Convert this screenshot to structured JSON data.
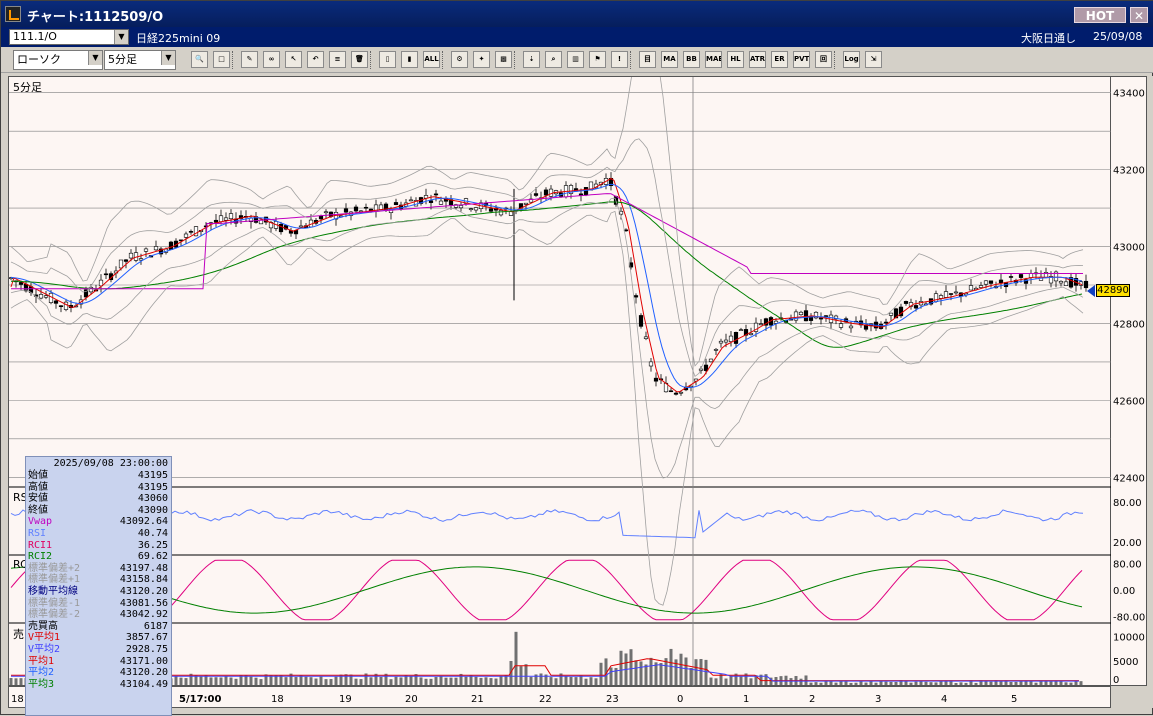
{
  "window": {
    "title": "チャート:1112509/O",
    "hot_label": "HOT",
    "close_label": "✕"
  },
  "infobar": {
    "symbol": "111.1/O",
    "instrument": "日経225mini 09",
    "market": "大阪日通し",
    "date": "25/09/08"
  },
  "toolbar": {
    "chart_style": "ローソク",
    "interval": "5分足",
    "buttons": [
      {
        "name": "zoom",
        "label": "🔍"
      },
      {
        "name": "window",
        "label": "□"
      },
      {
        "name": "draw-line",
        "label": "✎"
      },
      {
        "name": "link",
        "label": "∞"
      },
      {
        "name": "cursor",
        "label": "↖"
      },
      {
        "name": "undo",
        "label": "↶"
      },
      {
        "name": "notes",
        "label": "≡"
      },
      {
        "name": "trash",
        "label": "🗑"
      },
      {
        "name": "candle",
        "label": "▯"
      },
      {
        "name": "bars",
        "label": "▮"
      },
      {
        "name": "all",
        "label": "ALL"
      },
      {
        "name": "settings",
        "label": "⚙"
      },
      {
        "name": "wrench",
        "label": "✦"
      },
      {
        "name": "color",
        "label": "▩"
      },
      {
        "name": "import",
        "label": "⇣"
      },
      {
        "name": "search",
        "label": "⌕"
      },
      {
        "name": "volume",
        "label": "▥"
      },
      {
        "name": "flag",
        "label": "⚑"
      },
      {
        "name": "blank",
        "label": "!"
      },
      {
        "name": "ichimoku",
        "label": "目"
      },
      {
        "name": "ma",
        "label": "MA"
      },
      {
        "name": "bb",
        "label": "BB"
      },
      {
        "name": "mae",
        "label": "MAE"
      },
      {
        "name": "hl",
        "label": "HL"
      },
      {
        "name": "atr",
        "label": "ATR"
      },
      {
        "name": "env",
        "label": "ER"
      },
      {
        "name": "pvt",
        "label": "PVT"
      },
      {
        "name": "box",
        "label": "回"
      },
      {
        "name": "log",
        "label": "Log"
      },
      {
        "name": "export",
        "label": "⇲"
      }
    ]
  },
  "chart": {
    "panel_label": "5分足",
    "rsi_label": "RS",
    "rci_label": "RC",
    "vol_label": "売",
    "current_price": "42890",
    "price_ticks": [
      "43400",
      "43200",
      "43000",
      "42800",
      "42600",
      "42400"
    ],
    "rsi_ticks": [
      "80.00",
      "20.00"
    ],
    "rci_ticks": [
      "80.00",
      "0.00",
      "-80.00"
    ],
    "vol_ticks": [
      "10000",
      "5000",
      "0"
    ],
    "x_labels": [
      "18",
      "5/17:00",
      "18",
      "19",
      "20",
      "21",
      "22",
      "23",
      "0",
      "1",
      "2",
      "3",
      "4",
      "5"
    ]
  },
  "chart_data": {
    "type": "candlestick",
    "ylim": [
      42380,
      43420
    ],
    "current": 42890,
    "series_names": [],
    "indicators": {
      "rsi_range": [
        0,
        100
      ],
      "rci_range": [
        -100,
        100
      ],
      "vol_range": [
        0,
        12000
      ]
    }
  },
  "info": {
    "datetime": "2025/09/08 23:00:00",
    "rows": [
      {
        "label": "始値",
        "value": "43195",
        "color": "#000"
      },
      {
        "label": "高値",
        "value": "43195",
        "color": "#000"
      },
      {
        "label": "安値",
        "value": "43060",
        "color": "#000"
      },
      {
        "label": "終値",
        "value": "43090",
        "color": "#000"
      },
      {
        "label": "Vwap",
        "value": "43092.64",
        "color": "#c000c0"
      },
      {
        "label": "RSI",
        "value": "40.74",
        "color": "#6080ff"
      },
      {
        "label": "RCI1",
        "value": "36.25",
        "color": "#e00060"
      },
      {
        "label": "RCI2",
        "value": "69.62",
        "color": "#008000"
      },
      {
        "label": "標準偏差+2",
        "value": "43197.48",
        "color": "#999"
      },
      {
        "label": "標準偏差+1",
        "value": "43158.84",
        "color": "#999"
      },
      {
        "label": "移動平均線",
        "value": "43120.20",
        "color": "#000080"
      },
      {
        "label": "標準偏差-1",
        "value": "43081.56",
        "color": "#999"
      },
      {
        "label": "標準偏差-2",
        "value": "43042.92",
        "color": "#999"
      },
      {
        "label": "売買高",
        "value": "6187",
        "color": "#000"
      },
      {
        "label": "V平均1",
        "value": "3857.67",
        "color": "#e00000"
      },
      {
        "label": "V平均2",
        "value": "2928.75",
        "color": "#4040ff"
      },
      {
        "label": "平均1",
        "value": "43171.00",
        "color": "#e00000"
      },
      {
        "label": "平均2",
        "value": "43120.20",
        "color": "#2060ff"
      },
      {
        "label": "平均3",
        "value": "43104.49",
        "color": "#008000"
      }
    ]
  }
}
